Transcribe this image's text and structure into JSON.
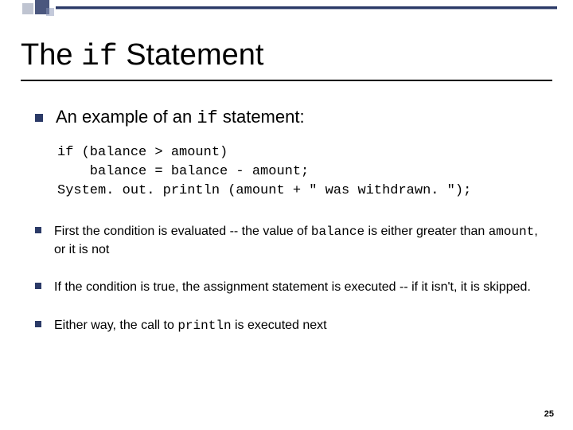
{
  "title": {
    "pre": "The ",
    "code": "if",
    "post": " Statement"
  },
  "intro": {
    "pre": "An example of an ",
    "code": "if",
    "post": " statement:"
  },
  "code": {
    "l1": "if (balance > amount)",
    "l2": "    balance = balance - amount;",
    "l3": "System. out. println (amount + \" was withdrawn. \");"
  },
  "bullets": {
    "b1": {
      "t1": "First the condition is evaluated -- the value of ",
      "c1": "balance",
      "t2": " is either greater than ",
      "c2": "amount",
      "t3": ", or it is not"
    },
    "b2": {
      "t1": "If the condition is true, the assignment statement is executed -- if it isn't, it is skipped."
    },
    "b3": {
      "t1": "Either way, the call to ",
      "c1": "println",
      "t2": " is executed next"
    }
  },
  "page": "25"
}
